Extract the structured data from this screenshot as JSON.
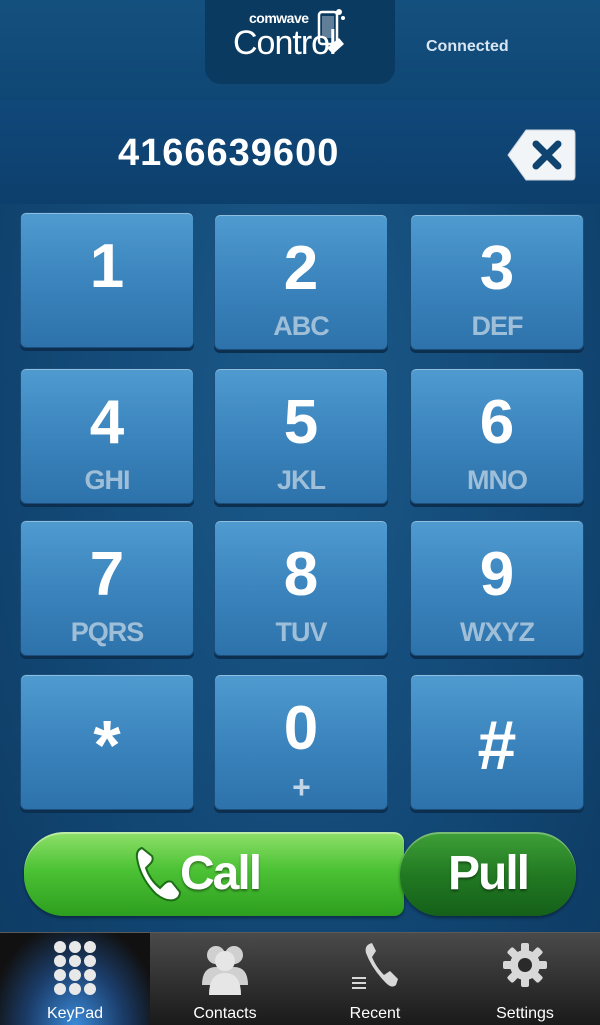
{
  "header": {
    "brand_small": "comwave",
    "brand_main": "Control",
    "status": "Connected"
  },
  "display": {
    "number": "4166639600"
  },
  "keypad": [
    {
      "digit": "1",
      "letters": ""
    },
    {
      "digit": "2",
      "letters": "ABC"
    },
    {
      "digit": "3",
      "letters": "DEF"
    },
    {
      "digit": "4",
      "letters": "GHI"
    },
    {
      "digit": "5",
      "letters": "JKL"
    },
    {
      "digit": "6",
      "letters": "MNO"
    },
    {
      "digit": "7",
      "letters": "PQRS"
    },
    {
      "digit": "8",
      "letters": "TUV"
    },
    {
      "digit": "9",
      "letters": "WXYZ"
    },
    {
      "digit": "*",
      "letters": ""
    },
    {
      "digit": "0",
      "letters": "+"
    },
    {
      "digit": "#",
      "letters": ""
    }
  ],
  "actions": {
    "call_label": "Call",
    "pull_label": "Pull"
  },
  "tabs": [
    {
      "label": "KeyPad",
      "icon": "keypad-icon",
      "active": true
    },
    {
      "label": "Contacts",
      "icon": "contacts-icon",
      "active": false
    },
    {
      "label": "Recent",
      "icon": "recent-icon",
      "active": false
    },
    {
      "label": "Settings",
      "icon": "gear-icon",
      "active": false
    }
  ],
  "colors": {
    "background": "#134a78",
    "key": "#3d86bf",
    "call": "#4cc235",
    "pull": "#227a22",
    "tabbar": "#1a1a1a",
    "tab_active": "#3a8ad8"
  }
}
